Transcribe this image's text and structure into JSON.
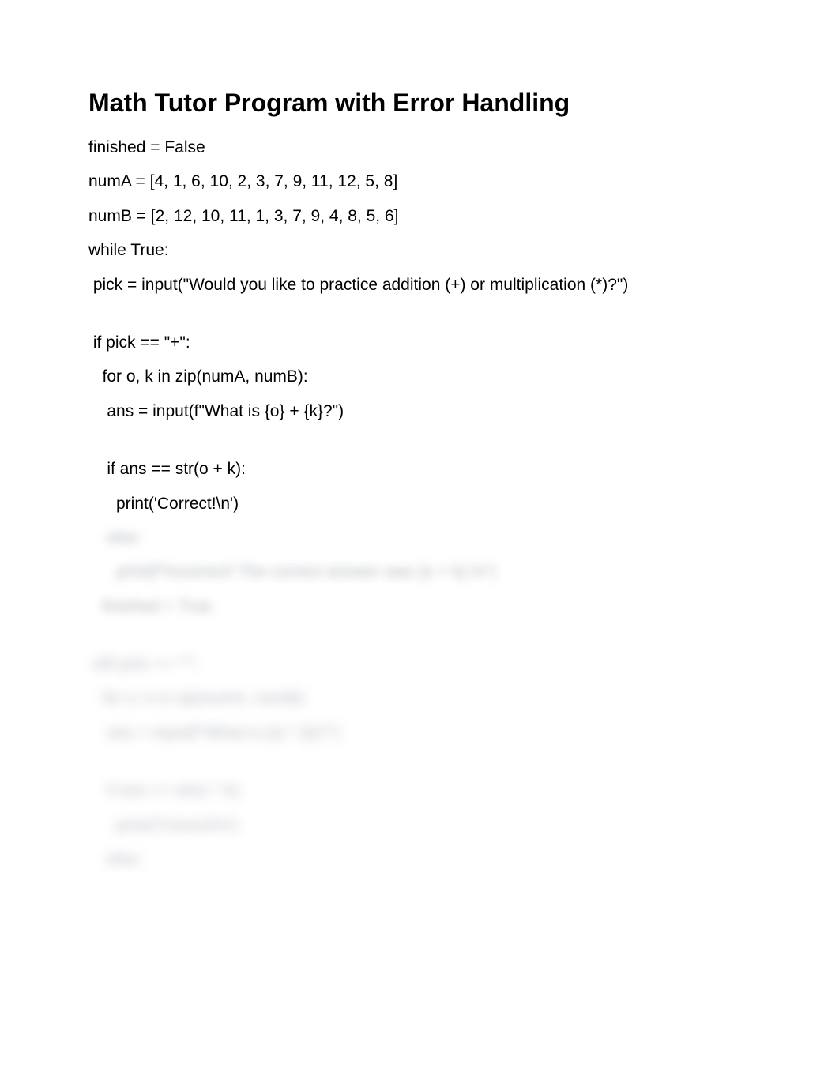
{
  "title": "Math Tutor Program with Error Handling",
  "code": {
    "l1": "finished = False",
    "l2": "numA = [4, 1, 6, 10, 2, 3, 7, 9, 11, 12, 5, 8]",
    "l3": "numB = [2, 12, 10, 11, 1, 3, 7, 9, 4, 8, 5, 6]",
    "l4": "while True:",
    "l5": " pick = input(\"Would you like to practice addition (+) or multiplication (*)?\")",
    "l6": " if pick == \"+\":",
    "l7": "   for o, k in zip(numA, numB):",
    "l8": "    ans = input(f\"What is {o} + {k}?\")",
    "l9": "    if ans == str(o + k):",
    "l10": "      print('Correct!\\n')",
    "b1": "    else:",
    "b2": "      print(f\"Incorrect! The correct answer was {o + k}.\\n\")",
    "b3": "   finished = True",
    "b4": " elif pick == \"*\":",
    "b5": "   for o, k in zip(numA, numB):",
    "b6": "    ans = input(f\"What is {o} * {k}?\")",
    "b7": "    if ans == str(o * k):",
    "b8": "      print('Correct!\\n')",
    "b9": "    else:"
  }
}
